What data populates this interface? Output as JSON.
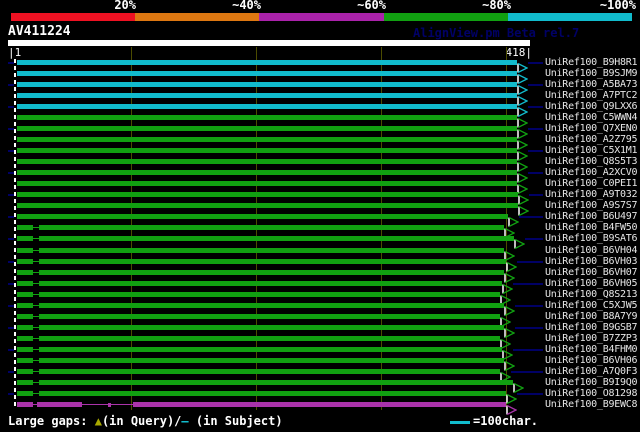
{
  "legend": {
    "labels": [
      "20%",
      "~40%",
      "~60%",
      "~80%",
      "~100%"
    ],
    "colors": [
      "#ee1122",
      "#dd7711",
      "#aa22aa",
      "#11a011",
      "#11bbcc"
    ]
  },
  "query": {
    "name": "AV411224",
    "app_title": "AlignView.pm Beta rel.7",
    "scale_start": "|1",
    "scale_end": "418|",
    "length": 418
  },
  "colors": {
    "cyan": "#11bbcc",
    "green": "#11a011",
    "purple": "#aa33aa",
    "link": "#000066",
    "grid": "#4c4c00",
    "white": "#ffffff"
  },
  "hits": [
    {
      "label": "UniRef100_B9H8R1",
      "color": "cyan",
      "link": true,
      "end": 517,
      "segments": [
        [
          17,
          517,
          "thick"
        ]
      ]
    },
    {
      "label": "UniRef100_B9SJM9",
      "color": "cyan",
      "link": false,
      "end": 517,
      "segments": [
        [
          17,
          517,
          "thick"
        ]
      ]
    },
    {
      "label": "UniRef100_A5BA73",
      "color": "cyan",
      "link": true,
      "end": 517,
      "segments": [
        [
          17,
          517,
          "thick"
        ]
      ]
    },
    {
      "label": "UniRef100_A7PTC2",
      "color": "cyan",
      "link": false,
      "end": 517,
      "segments": [
        [
          17,
          517,
          "thick"
        ]
      ]
    },
    {
      "label": "UniRef100_Q9LXX6",
      "color": "cyan",
      "link": true,
      "end": 517,
      "segments": [
        [
          17,
          517,
          "thick"
        ]
      ]
    },
    {
      "label": "UniRef100_C5WWN4",
      "color": "green",
      "link": false,
      "end": 517,
      "segments": [
        [
          17,
          517,
          "thick"
        ]
      ]
    },
    {
      "label": "UniRef100_Q7XEN0",
      "color": "green",
      "link": true,
      "end": 517,
      "segments": [
        [
          17,
          517,
          "thick"
        ]
      ]
    },
    {
      "label": "UniRef100_A2Z795",
      "color": "green",
      "link": false,
      "end": 517,
      "segments": [
        [
          17,
          517,
          "thick"
        ]
      ]
    },
    {
      "label": "UniRef100_C5X1M1",
      "color": "green",
      "link": true,
      "end": 517,
      "segments": [
        [
          17,
          517,
          "thick"
        ]
      ]
    },
    {
      "label": "UniRef100_Q8S5T3",
      "color": "green",
      "link": false,
      "end": 517,
      "segments": [
        [
          17,
          517,
          "thick"
        ]
      ]
    },
    {
      "label": "UniRef100_A2XCV0",
      "color": "green",
      "link": true,
      "end": 517,
      "segments": [
        [
          17,
          517,
          "thick"
        ]
      ]
    },
    {
      "label": "UniRef100_C0PEI1",
      "color": "green",
      "link": false,
      "end": 517,
      "segments": [
        [
          17,
          517,
          "thick"
        ]
      ]
    },
    {
      "label": "UniRef100_A9T032",
      "color": "green",
      "link": true,
      "end": 518,
      "segments": [
        [
          17,
          518,
          "thick"
        ]
      ]
    },
    {
      "label": "UniRef100_A9S7S7",
      "color": "green",
      "link": false,
      "end": 518,
      "segments": [
        [
          17,
          518,
          "thick"
        ]
      ]
    },
    {
      "label": "UniRef100_B6U497",
      "color": "green",
      "link": true,
      "end": 508,
      "segments": [
        [
          17,
          508,
          "thick"
        ]
      ]
    },
    {
      "label": "UniRef100_B4FW50",
      "color": "green",
      "link": false,
      "end": 504,
      "segments": [
        [
          17,
          33,
          "thick"
        ],
        [
          33,
          39,
          "thin"
        ],
        [
          39,
          504,
          "thick"
        ]
      ]
    },
    {
      "label": "UniRef100_B9SAT6",
      "color": "green",
      "link": true,
      "end": 514,
      "segments": [
        [
          17,
          33,
          "thick"
        ],
        [
          33,
          39,
          "thin"
        ],
        [
          39,
          514,
          "thick"
        ]
      ]
    },
    {
      "label": "UniRef100_B6VH04",
      "color": "green",
      "link": false,
      "end": 504,
      "segments": [
        [
          17,
          33,
          "thick"
        ],
        [
          33,
          39,
          "thin"
        ],
        [
          39,
          504,
          "thick"
        ]
      ]
    },
    {
      "label": "UniRef100_B6VH03",
      "color": "green",
      "link": true,
      "end": 506,
      "segments": [
        [
          17,
          33,
          "thick"
        ],
        [
          33,
          39,
          "thin"
        ],
        [
          39,
          506,
          "thick"
        ]
      ]
    },
    {
      "label": "UniRef100_B6VH07",
      "color": "green",
      "link": false,
      "end": 504,
      "segments": [
        [
          17,
          33,
          "thick"
        ],
        [
          33,
          39,
          "thin"
        ],
        [
          39,
          504,
          "thick"
        ]
      ]
    },
    {
      "label": "UniRef100_B6VH05",
      "color": "green",
      "link": true,
      "end": 502,
      "segments": [
        [
          17,
          33,
          "thick"
        ],
        [
          33,
          39,
          "thin"
        ],
        [
          39,
          502,
          "thick"
        ]
      ]
    },
    {
      "label": "UniRef100_Q8S213",
      "color": "green",
      "link": false,
      "end": 500,
      "segments": [
        [
          17,
          33,
          "thick"
        ],
        [
          33,
          39,
          "thin"
        ],
        [
          39,
          500,
          "thick"
        ]
      ]
    },
    {
      "label": "UniRef100_C5XJW5",
      "color": "green",
      "link": true,
      "end": 504,
      "segments": [
        [
          17,
          33,
          "thick"
        ],
        [
          33,
          39,
          "thin"
        ],
        [
          39,
          504,
          "thick"
        ]
      ]
    },
    {
      "label": "UniRef100_B8A7Y9",
      "color": "green",
      "link": false,
      "end": 500,
      "segments": [
        [
          17,
          33,
          "thick"
        ],
        [
          33,
          39,
          "thin"
        ],
        [
          39,
          500,
          "thick"
        ]
      ]
    },
    {
      "label": "UniRef100_B9GSB7",
      "color": "green",
      "link": true,
      "end": 504,
      "segments": [
        [
          17,
          33,
          "thick"
        ],
        [
          33,
          39,
          "thin"
        ],
        [
          39,
          504,
          "thick"
        ]
      ]
    },
    {
      "label": "UniRef100_B7ZZP3",
      "color": "green",
      "link": false,
      "end": 500,
      "segments": [
        [
          17,
          33,
          "thick"
        ],
        [
          33,
          39,
          "thin"
        ],
        [
          39,
          500,
          "thick"
        ]
      ]
    },
    {
      "label": "UniRef100_B4FHM0",
      "color": "green",
      "link": true,
      "end": 502,
      "segments": [
        [
          17,
          33,
          "thick"
        ],
        [
          33,
          39,
          "thin"
        ],
        [
          39,
          502,
          "thick"
        ]
      ]
    },
    {
      "label": "UniRef100_B6VH06",
      "color": "green",
      "link": false,
      "end": 504,
      "segments": [
        [
          17,
          33,
          "thick"
        ],
        [
          33,
          39,
          "thin"
        ],
        [
          39,
          504,
          "thick"
        ]
      ]
    },
    {
      "label": "UniRef100_A7Q0F3",
      "color": "green",
      "link": true,
      "end": 500,
      "segments": [
        [
          17,
          33,
          "thick"
        ],
        [
          33,
          39,
          "thin"
        ],
        [
          39,
          500,
          "thick"
        ]
      ]
    },
    {
      "label": "UniRef100_B9I9Q0",
      "color": "green",
      "link": false,
      "end": 513,
      "segments": [
        [
          17,
          33,
          "thick"
        ],
        [
          33,
          39,
          "thin"
        ],
        [
          39,
          513,
          "thick"
        ]
      ]
    },
    {
      "label": "UniRef100_O81298",
      "color": "green",
      "link": true,
      "end": 506,
      "segments": [
        [
          17,
          33,
          "thick"
        ],
        [
          33,
          39,
          "thin"
        ],
        [
          39,
          506,
          "thick"
        ]
      ]
    },
    {
      "label": "UniRef100_B9EWC8",
      "color": "purple",
      "link": false,
      "end": 506,
      "segments": [
        [
          17,
          33,
          "thick"
        ],
        [
          33,
          37,
          "thin"
        ],
        [
          37,
          82,
          "thick"
        ],
        [
          82,
          133,
          "thin"
        ],
        [
          108,
          111,
          "tick"
        ],
        [
          133,
          506,
          "thick"
        ]
      ]
    }
  ],
  "footer": {
    "gaps_prefix": "Large gaps: ",
    "gap_query_symbol": "▲",
    "gap_query_color": "#aaaa00",
    "gaps_mid": "(in Query)/",
    "gap_subject_symbol": "–",
    "gap_subject_color": "#11bbcc",
    "gaps_suffix": " (in Subject)",
    "scale_label": "=100char."
  }
}
